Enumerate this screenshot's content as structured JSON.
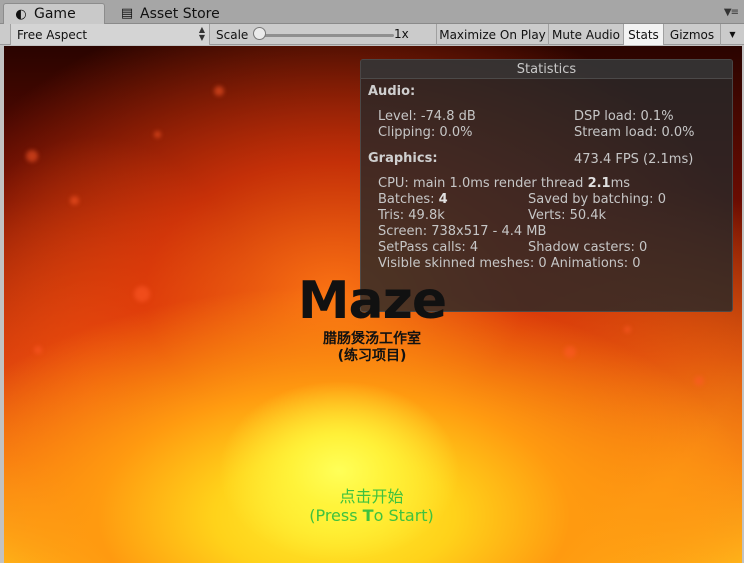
{
  "tabs": [
    {
      "label": "Game",
      "icon": "game-controller-icon"
    },
    {
      "label": "Asset Store",
      "icon": "shopping-bag-icon"
    }
  ],
  "toolbar": {
    "aspect": "Free Aspect",
    "scale_label": "Scale",
    "scale_value": "1x",
    "maximize_on_play": "Maximize On Play",
    "mute_audio": "Mute Audio",
    "stats": "Stats",
    "gizmos": "Gizmos"
  },
  "statistics": {
    "title": "Statistics",
    "audio_header": "Audio:",
    "level": "Level: -74.8 dB",
    "dsp_load": "DSP load: 0.1%",
    "clipping": "Clipping: 0.0%",
    "stream_load": "Stream load: 0.0%",
    "graphics_header": "Graphics:",
    "fps": "473.4 FPS (2.1ms)",
    "cpu_prefix": "CPU: main 1.0ms  render thread ",
    "cpu_render_value": "2.1",
    "cpu_suffix": "ms",
    "batches_label": "Batches: ",
    "batches_value": "4",
    "saved_by_batching": "Saved by batching: 0",
    "tris": "Tris: 49.8k",
    "verts": "Verts: 50.4k",
    "screen": "Screen: 738x517 - 4.4 MB",
    "setpass": "SetPass calls: 4",
    "shadow_casters": "Shadow casters: 0",
    "skinned": "Visible skinned meshes: 0  Animations: 0"
  },
  "game": {
    "title": "Maze",
    "subtitle_line1": "腊肠煲汤工作室",
    "subtitle_line2": "(练习项目)",
    "start_cn": "点击开始",
    "start_en_prefix": "(Press ",
    "start_en_t": "T",
    "start_en_suffix": "o Start)",
    "start_color": "#3ec23e",
    "title_color": "#111111"
  }
}
